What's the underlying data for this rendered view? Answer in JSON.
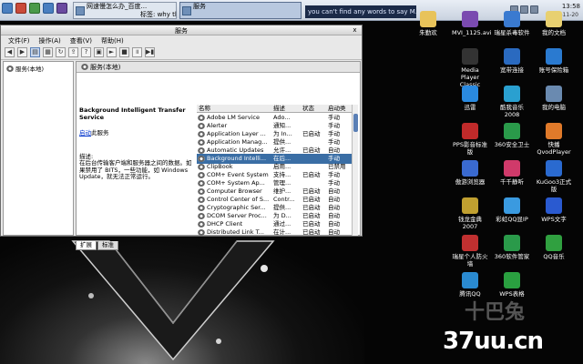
{
  "taskbar": {
    "tasks": [
      {
        "label": "网速慢怎么办_百度..."
      },
      {
        "label": "标签: why tlie"
      },
      {
        "label": "服务"
      }
    ],
    "marquee": "you can't find any words to say  M...",
    "clock": "13:58",
    "date": "2010-11-20"
  },
  "window": {
    "title": "服务",
    "close": "x",
    "menu": [
      "文件(F)",
      "操作(A)",
      "查看(V)",
      "帮助(H)"
    ],
    "tree_root": "服务(本地)",
    "pane_header": "服务(本地)",
    "desc_title": "Background Intelligent Transfer Service",
    "desc_start_link": "启动",
    "desc_start_suffix": "此服务",
    "desc_label": "描述:",
    "desc_text": "在后台传输客户端和服务器之间的数据。如果禁用了 BITS，一些功能，如 Windows Update，就无法正常运行。",
    "columns": [
      "名称",
      "描述",
      "状态",
      "启动类"
    ],
    "rows": [
      {
        "name": "Adobe LM Service",
        "desc": "Ado...",
        "status": "",
        "start": "手动"
      },
      {
        "name": "Alerter",
        "desc": "通知...",
        "status": "",
        "start": "手动"
      },
      {
        "name": "Application Layer ...",
        "desc": "为 In...",
        "status": "已启动",
        "start": "手动"
      },
      {
        "name": "Application Manag...",
        "desc": "提供...",
        "status": "",
        "start": "手动"
      },
      {
        "name": "Automatic Updates",
        "desc": "允许...",
        "status": "已启动",
        "start": "自动"
      },
      {
        "name": "Background Intelli...",
        "desc": "在后...",
        "status": "",
        "start": "手动"
      },
      {
        "name": "ClipBook",
        "desc": "启用...",
        "status": "",
        "start": "已禁用"
      },
      {
        "name": "COM+ Event System",
        "desc": "支持...",
        "status": "已启动",
        "start": "手动"
      },
      {
        "name": "COM+ System Ap...",
        "desc": "管理...",
        "status": "",
        "start": "手动"
      },
      {
        "name": "Computer Browser",
        "desc": "维护...",
        "status": "已启动",
        "start": "自动"
      },
      {
        "name": "Control Center of S...",
        "desc": "Contr...",
        "status": "已启动",
        "start": "自动"
      },
      {
        "name": "Cryptographic Ser...",
        "desc": "提供...",
        "status": "已启动",
        "start": "自动"
      },
      {
        "name": "DCOM Server Proc...",
        "desc": "为 D...",
        "status": "已启动",
        "start": "自动"
      },
      {
        "name": "DHCP Client",
        "desc": "通过...",
        "status": "已启动",
        "start": "自动"
      },
      {
        "name": "Distributed Link T...",
        "desc": "在计...",
        "status": "已启动",
        "start": "自动"
      }
    ],
    "selected_row": 5,
    "tabs": [
      "扩展",
      "标准"
    ]
  },
  "desktop_icons": [
    {
      "label": "朱勤欢",
      "color": "#e8c35a"
    },
    {
      "label": "MVI_1125.avi",
      "color": "#7a4ab0"
    },
    {
      "label": "瑞星杀毒软件",
      "color": "#3a7ad0"
    },
    {
      "label": "我的文档",
      "color": "#e8d070"
    },
    {
      "label": "Media Player Classic",
      "color": "#333333"
    },
    {
      "label": "宽带连接",
      "color": "#2a6ac0"
    },
    {
      "label": "账号保险箱",
      "color": "#2a7ad0"
    },
    {
      "label": "迅雷",
      "color": "#2a8ae0"
    },
    {
      "label": "酷我音乐2008",
      "color": "#2aa0d0"
    },
    {
      "label": "我的电脑",
      "color": "#6a8ab0"
    },
    {
      "label": "PPS影音标准版",
      "color": "#c02a2a"
    },
    {
      "label": "360安全卫士",
      "color": "#2a9a4a"
    },
    {
      "label": "快播QvodPlayer",
      "color": "#e07a2a"
    },
    {
      "label": "傲游浏览器",
      "color": "#3a6ad0"
    },
    {
      "label": "千千静听",
      "color": "#d03a6a"
    },
    {
      "label": "KuGoo3正式版",
      "color": "#2a6ad0"
    },
    {
      "label": "钱龙金典2007",
      "color": "#c0a030"
    },
    {
      "label": "彩虹QQ显IP",
      "color": "#3a9ae0"
    },
    {
      "label": "WPS文字",
      "color": "#2a5ad0"
    },
    {
      "label": "瑞星个人防火墙",
      "color": "#c03030"
    },
    {
      "label": "360软件管家",
      "color": "#2a9a4a"
    },
    {
      "label": "QQ音乐",
      "color": "#30a040"
    },
    {
      "label": "腾讯QQ",
      "color": "#2a8ad0"
    },
    {
      "label": "WPS表格",
      "color": "#2aa040"
    }
  ],
  "watermark": {
    "main": "37uu.cn",
    "ghost": "十巴兔"
  }
}
